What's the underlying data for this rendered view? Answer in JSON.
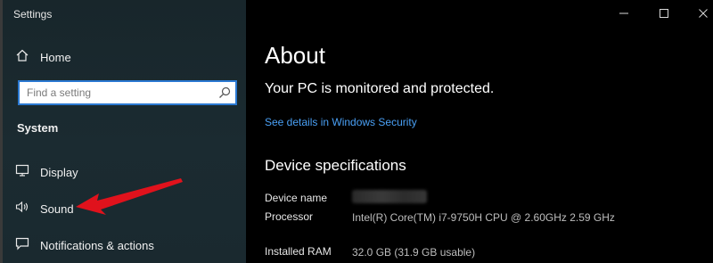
{
  "window": {
    "title": "Settings"
  },
  "sidebar": {
    "home_label": "Home",
    "search_placeholder": "Find a setting",
    "section_title": "System",
    "items": [
      {
        "label": "Display",
        "icon": "monitor-icon"
      },
      {
        "label": "Sound",
        "icon": "speaker-icon"
      },
      {
        "label": "Notifications & actions",
        "icon": "notification-icon"
      }
    ]
  },
  "main": {
    "title": "About",
    "status": "Your PC is monitored and protected.",
    "security_link": "See details in Windows Security",
    "spec_title": "Device specifications",
    "specs": [
      {
        "label": "Device name",
        "value": ""
      },
      {
        "label": "Processor",
        "value": "Intel(R) Core(TM) i7-9750H CPU @ 2.60GHz   2.59 GHz"
      },
      {
        "label": "Installed RAM",
        "value": "32.0 GB (31.9 GB usable)"
      }
    ]
  },
  "colors": {
    "sidebar_bg": "#1b2b31",
    "accent": "#2b79d2",
    "link": "#4aa0f5",
    "annotation_arrow": "#e0121c"
  }
}
